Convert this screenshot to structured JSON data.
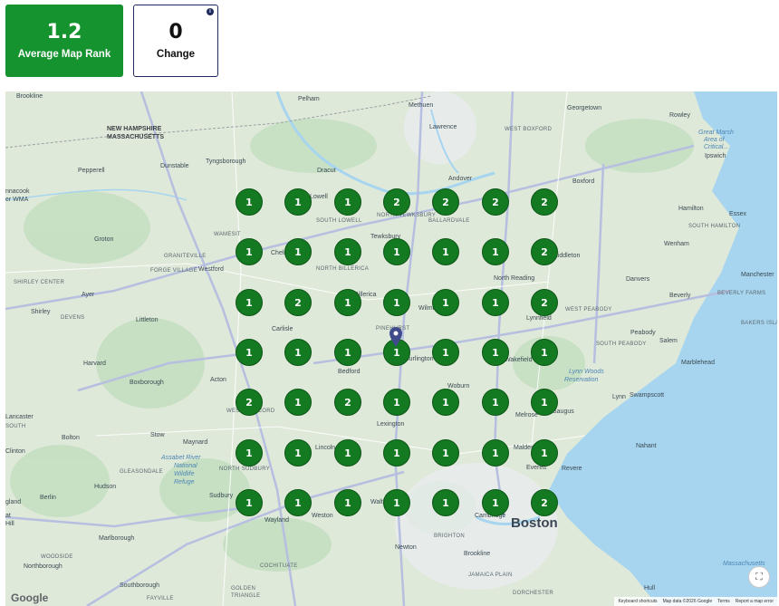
{
  "summary": {
    "average_rank_value": "1.2",
    "average_rank_label": "Average Map Rank",
    "change_value": "0",
    "change_label": "Change",
    "info_icon": "i"
  },
  "colors": {
    "rank_card": "#14932f",
    "marker": "#147a22",
    "pin": "#3f4b8a",
    "water": "#a7d5ef",
    "land": "#dfe9d9"
  },
  "grid": {
    "rows": [
      [
        "1",
        "1",
        "1",
        "2",
        "2",
        "2",
        "2"
      ],
      [
        "1",
        "1",
        "1",
        "1",
        "1",
        "1",
        "2"
      ],
      [
        "1",
        "2",
        "1",
        "1",
        "1",
        "1",
        "2"
      ],
      [
        "1",
        "1",
        "1",
        "1",
        "1",
        "1",
        "1"
      ],
      [
        "2",
        "1",
        "2",
        "1",
        "1",
        "1",
        "1"
      ],
      [
        "1",
        "1",
        "1",
        "1",
        "1",
        "1",
        "1"
      ],
      [
        "1",
        "1",
        "1",
        "1",
        "1",
        "1",
        "2"
      ]
    ]
  },
  "map": {
    "labels": {
      "brookline_nh": "Brookline",
      "pelham": "Pelham",
      "methuen": "Methuen",
      "georgetown": "Georgetown",
      "rowley": "Rowley",
      "nh": "NEW HAMPSHIRE",
      "ma": "MASSACHUSETTS",
      "lawrence": "Lawrence",
      "west_boxford": "WEST BOXFORD",
      "great_marsh": "Great Marsh",
      "area_of": "Area of",
      "critical": "Critical...",
      "ipswich": "Ipswich",
      "pepperell": "Pepperell",
      "dunstable": "Dunstable",
      "tyngsborough": "Tyngsborough",
      "dracut": "Dracut",
      "andover": "Andover",
      "boxford": "Boxford",
      "nacook": "nnacook",
      "wma": "er WMA",
      "lowell": "Lowell",
      "s_lowell": "SOUTH LOWELL",
      "tewksbury": "Tewksbury",
      "n_tewksbury": "NORTH TEWKSBURY",
      "ballardvale": "BALLARDVALE",
      "hamilton": "Hamilton",
      "essex": "Essex",
      "s_hamilton": "SOUTH HAMILTON",
      "wenham": "Wenham",
      "groton": "Groton",
      "wamesit": "WAMESIT",
      "graniteville": "GRANITEVILLE",
      "forge_village": "FORGE VILLAGE",
      "westford": "Westford",
      "chelmsford": "Chelmsford",
      "n_billerica": "NORTH BILLERICA",
      "middleton": "Middleton",
      "north_reading": "North Reading",
      "danvers": "Danvers",
      "manchester": "Manchester",
      "shirley_center": "SHIRLEY CENTER",
      "ayer": "Ayer",
      "shirley": "Shirley",
      "devens": "DEVENS",
      "littleton": "Littleton",
      "billerica": "Billerica",
      "wilmington": "Wilmington",
      "lynnfield": "Lynnfield",
      "w_peabody": "WEST PEABODY",
      "beverly": "Beverly",
      "beverly_farms": "BEVERLY FARMS",
      "carlisle": "Carlisle",
      "pinehurst": "PINEHURST",
      "peabody": "Peabody",
      "s_peabody": "SOUTH PEABODY",
      "salem": "Salem",
      "bakers": "BAKERS ISLAND",
      "harvard": "Harvard",
      "burlington": "Burlington",
      "wakefield": "Wakefield",
      "marblehead": "Marblehead",
      "bedford": "Bedford",
      "lynn_woods": "Lynn Woods",
      "reservation": "Reservation",
      "boxborough": "Boxborough",
      "acton": "Acton",
      "lynn": "Lynn",
      "swampscott": "Swampscott",
      "w_concord": "WEST CONCORD",
      "woburn": "Woburn",
      "melrose": "Melrose",
      "saugus": "Saugus",
      "lancaster": "Lancaster",
      "south_lancaster": "SOUTH",
      "lexington": "Lexington",
      "bolton": "Bolton",
      "stow": "Stow",
      "maynard": "Maynard",
      "lincoln": "Lincoln",
      "malden": "Malden",
      "nahant": "Nahant",
      "clinton": "Clinton",
      "assabet1": "Assabet River",
      "assabet2": "National",
      "assabet3": "Wildlife",
      "assabet4": "Refuge",
      "n_sudbury": "NORTH SUDBURY",
      "everett": "Everett",
      "revere": "Revere",
      "gleasondale": "GLEASONDALE",
      "hudson": "Hudson",
      "berlin": "Berlin",
      "sudbury": "Sudbury",
      "waltham": "Waltham",
      "weston": "Weston",
      "cambridge": "Cambridge",
      "gland": "gland",
      "at": "at",
      "hill": "Hill",
      "wayland": "Wayland",
      "boston": "Boston",
      "marlborough": "Marlborough",
      "brighton": "BRIGHTON",
      "woodside": "WOODSIDE",
      "northborough": "Northborough",
      "cochituate": "COCHITUATE",
      "newton": "Newton",
      "brookline": "Brookline",
      "jamaica_plain": "JAMAICA PLAIN",
      "massachusetts_bay": "Massachusetts",
      "southborough": "Southborough",
      "golden": "GOLDEN",
      "triangle": "TRIANGLE",
      "fayville": "FAYVILLE",
      "dorchester": "DORCHESTER",
      "hull": "Hull"
    },
    "google": "Google",
    "footer": {
      "shortcuts": "Keyboard shortcuts",
      "map_data": "Map data ©2026 Google",
      "terms": "Terms",
      "report": "Report a map error"
    }
  }
}
